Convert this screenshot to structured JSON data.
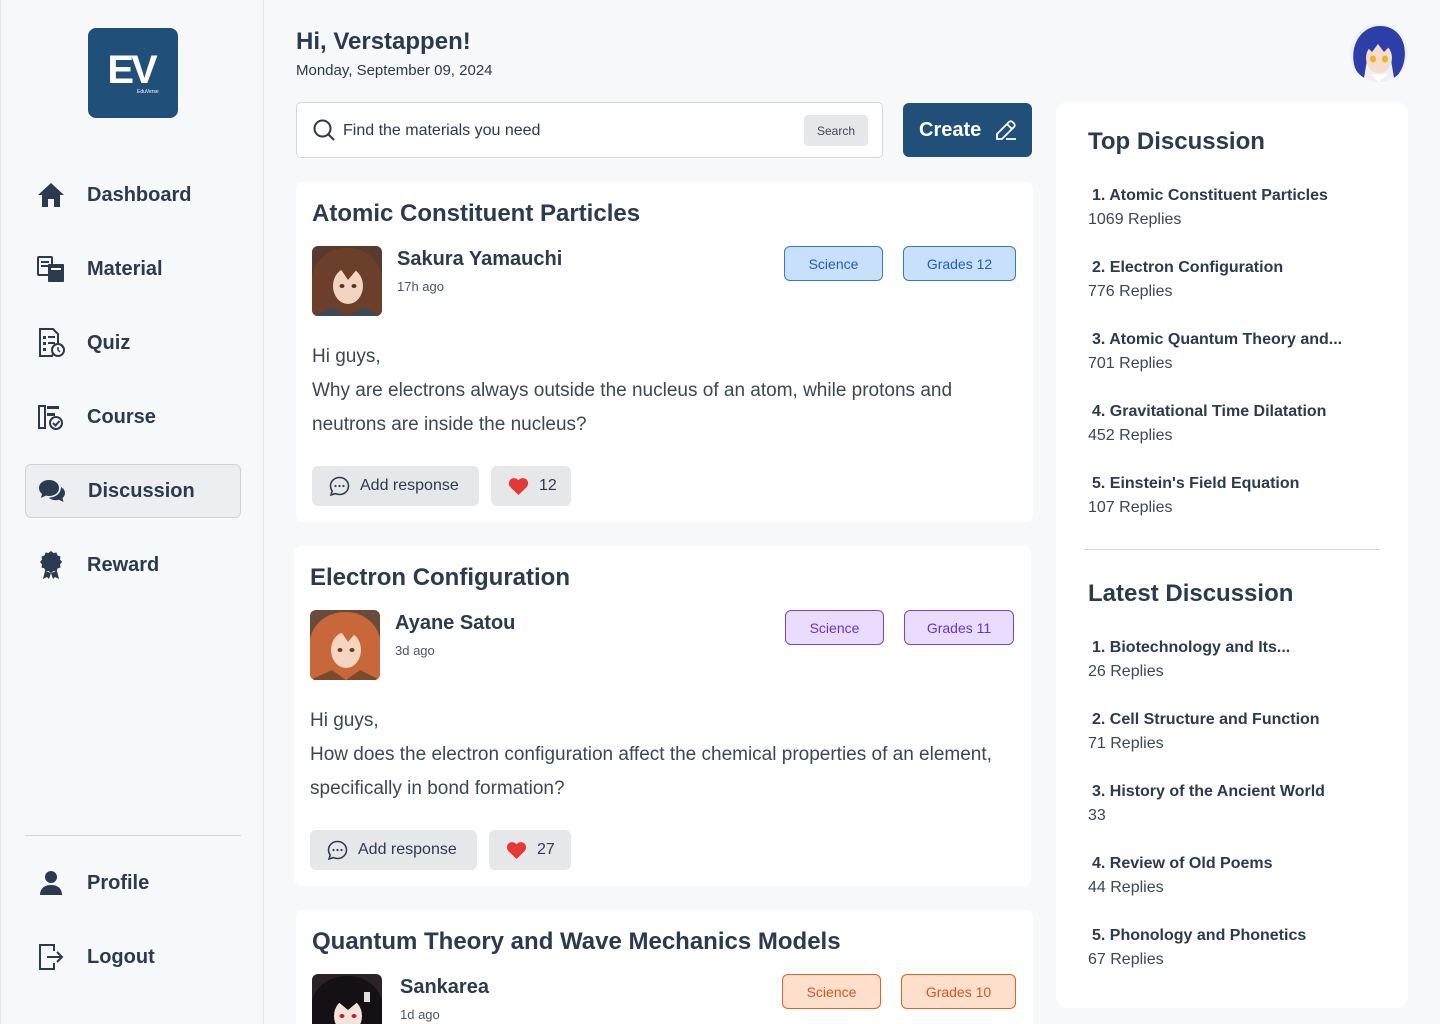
{
  "app": {
    "logo_text": "EV",
    "logo_subtext": "EduVerse"
  },
  "sidebar": {
    "items": [
      {
        "label": "Dashboard",
        "icon": "home-icon"
      },
      {
        "label": "Material",
        "icon": "material-icon"
      },
      {
        "label": "Quiz",
        "icon": "quiz-icon"
      },
      {
        "label": "Course",
        "icon": "course-icon"
      },
      {
        "label": "Discussion",
        "icon": "discussion-icon",
        "active": true
      },
      {
        "label": "Reward",
        "icon": "reward-icon"
      }
    ],
    "bottom_items": [
      {
        "label": "Profile",
        "icon": "person-icon"
      },
      {
        "label": "Logout",
        "icon": "logout-icon"
      }
    ]
  },
  "header": {
    "greeting": "Hi, Verstappen!",
    "date": "Monday, September 09, 2024"
  },
  "search": {
    "placeholder": "Find the materials you need",
    "button_label": "Search"
  },
  "create_button": {
    "label": "Create"
  },
  "posts": [
    {
      "title": "Atomic Constituent Particles",
      "author": "Sakura Yamauchi",
      "time": "17h ago",
      "tags": [
        "Science",
        "Grades 12"
      ],
      "tag_color": "#3a76d0",
      "body_line1": "Hi guys,",
      "body_line2": "Why are electrons always outside the nucleus of an atom, while protons and neutrons are inside the nucleus?",
      "response_label": "Add response",
      "likes": "12"
    },
    {
      "title": "Electron Configuration",
      "author": "Ayane Satou",
      "time": "3d ago",
      "tags": [
        "Science",
        "Grades 11"
      ],
      "tag_color": "#7a44cf",
      "body_line1": "Hi guys,",
      "body_line2": "How does the electron configuration affect the chemical properties of an element, specifically in bond formation?",
      "response_label": "Add response",
      "likes": "27"
    },
    {
      "title": "Quantum Theory and Wave Mechanics Models",
      "author": "Sankarea",
      "time": "1d ago",
      "tags": [
        "Science",
        "Grades 10"
      ],
      "tag_color": "#e0622a"
    }
  ],
  "top_discussion": {
    "heading": "Top Discussion",
    "items": [
      {
        "title": "1. Atomic Constituent Particles",
        "replies": "1069 Replies"
      },
      {
        "title": "2. Electron Configuration",
        "replies": "776 Replies"
      },
      {
        "title": "3. Atomic Quantum Theory and...",
        "replies": "701 Replies"
      },
      {
        "title": "4. Gravitational Time Dilatation",
        "replies": "452 Replies"
      },
      {
        "title": "5. Einstein's Field Equation",
        "replies": "107 Replies"
      }
    ]
  },
  "latest_discussion": {
    "heading": "Latest Discussion",
    "items": [
      {
        "title": "1. Biotechnology and Its...",
        "replies": "26 Replies"
      },
      {
        "title": "2. Cell Structure and Function",
        "replies": "71 Replies"
      },
      {
        "title": "3. History of the Ancient World",
        "replies": "33"
      },
      {
        "title": "4. Review of Old Poems",
        "replies": "44 Replies"
      },
      {
        "title": "5. Phonology and Phonetics",
        "replies": "67 Replies"
      }
    ]
  },
  "colors": {
    "brand": "#20507a",
    "like": "#e53935",
    "text": "#2b3a4e"
  }
}
